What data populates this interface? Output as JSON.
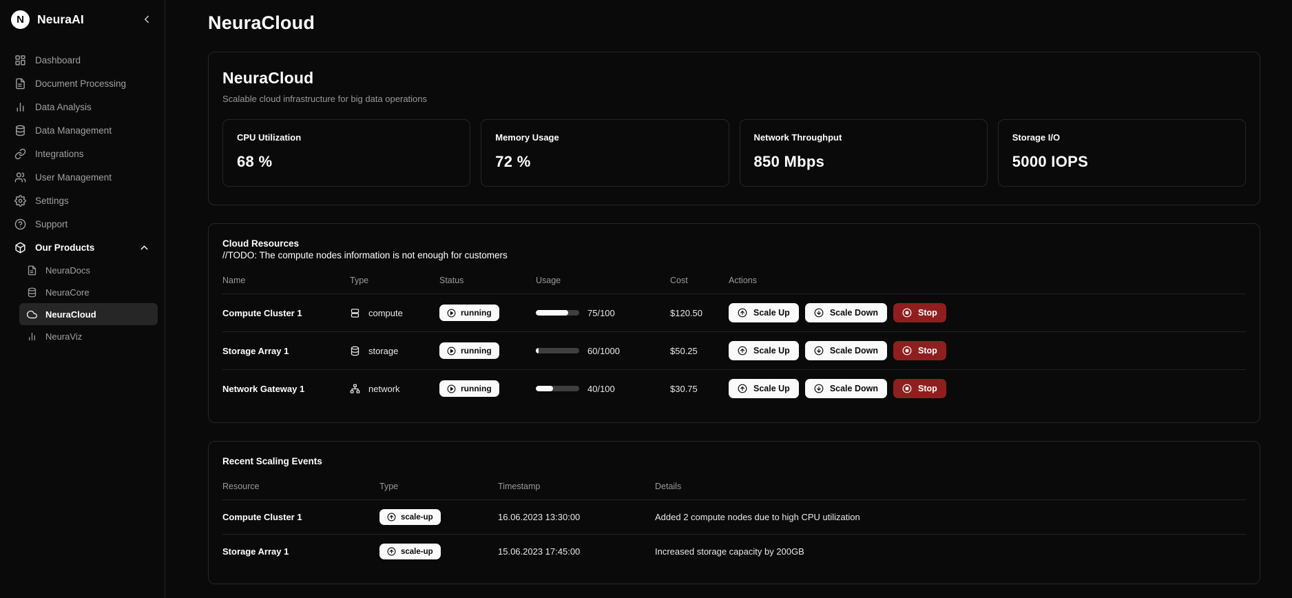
{
  "sidebar": {
    "brand": {
      "logo_letter": "N",
      "name": "NeuraAI",
      "collapse_icon": "chevron-left-icon"
    },
    "items": [
      {
        "label": "Dashboard",
        "icon": "dashboard-grid-icon"
      },
      {
        "label": "Document Processing",
        "icon": "document-icon"
      },
      {
        "label": "Data Analysis",
        "icon": "bar-chart-icon"
      },
      {
        "label": "Data Management",
        "icon": "database-icon"
      },
      {
        "label": "Integrations",
        "icon": "link-icon"
      },
      {
        "label": "User Management",
        "icon": "users-icon"
      },
      {
        "label": "Settings",
        "icon": "gear-icon"
      },
      {
        "label": "Support",
        "icon": "help-circle-icon"
      }
    ],
    "group": {
      "label": "Our Products",
      "icon": "box-icon",
      "chevron": "chevron-up-icon",
      "items": [
        {
          "label": "NeuraDocs",
          "icon": "document-icon",
          "active": false
        },
        {
          "label": "NeuraCore",
          "icon": "database-icon",
          "active": false
        },
        {
          "label": "NeuraCloud",
          "icon": "cloud-icon",
          "active": true
        },
        {
          "label": "NeuraViz",
          "icon": "bar-chart-icon",
          "active": false
        }
      ]
    }
  },
  "page": {
    "title": "NeuraCloud"
  },
  "hero": {
    "title": "NeuraCloud",
    "subtitle": "Scalable cloud infrastructure for big data operations",
    "metrics": [
      {
        "label": "CPU Utilization",
        "value": "68 %"
      },
      {
        "label": "Memory Usage",
        "value": "72 %"
      },
      {
        "label": "Network Throughput",
        "value": "850 Mbps"
      },
      {
        "label": "Storage I/O",
        "value": "5000 IOPS"
      }
    ]
  },
  "resources": {
    "title": "Cloud Resources",
    "note": "//TODO: The compute nodes information is not enough for customers",
    "columns": [
      "Name",
      "Type",
      "Status",
      "Usage",
      "Cost",
      "Actions"
    ],
    "buttons": {
      "scale_up": "Scale Up",
      "scale_down": "Scale Down",
      "stop": "Stop"
    },
    "rows": [
      {
        "name": "Compute Cluster 1",
        "type": "compute",
        "type_icon": "server-icon",
        "status": "running",
        "status_icon": "play-circle-icon",
        "usage_text": "75/100",
        "usage_percent": 75,
        "cost": "$120.50"
      },
      {
        "name": "Storage Array 1",
        "type": "storage",
        "type_icon": "database-icon",
        "status": "running",
        "status_icon": "play-circle-icon",
        "usage_text": "60/1000",
        "usage_percent": 6,
        "cost": "$50.25"
      },
      {
        "name": "Network Gateway 1",
        "type": "network",
        "type_icon": "network-icon",
        "status": "running",
        "status_icon": "play-circle-icon",
        "usage_text": "40/100",
        "usage_percent": 40,
        "cost": "$30.75"
      }
    ]
  },
  "events": {
    "title": "Recent Scaling Events",
    "columns": [
      "Resource",
      "Type",
      "Timestamp",
      "Details"
    ],
    "rows": [
      {
        "resource": "Compute Cluster 1",
        "type": "scale-up",
        "type_icon": "arrow-up-circle-icon",
        "timestamp": "16.06.2023 13:30:00",
        "details": "Added 2 compute nodes due to high CPU utilization"
      },
      {
        "resource": "Storage Array 1",
        "type": "scale-up",
        "type_icon": "arrow-up-circle-icon",
        "timestamp": "15.06.2023 17:45:00",
        "details": "Increased storage capacity by 200GB"
      }
    ]
  },
  "colors": {
    "background": "#0a0a0a",
    "border": "#262626",
    "text_primary": "#ffffff",
    "text_muted": "#9a9a9a",
    "badge_bg": "#fafafa",
    "danger": "#8f1f1f",
    "active_item_bg": "#262626"
  }
}
